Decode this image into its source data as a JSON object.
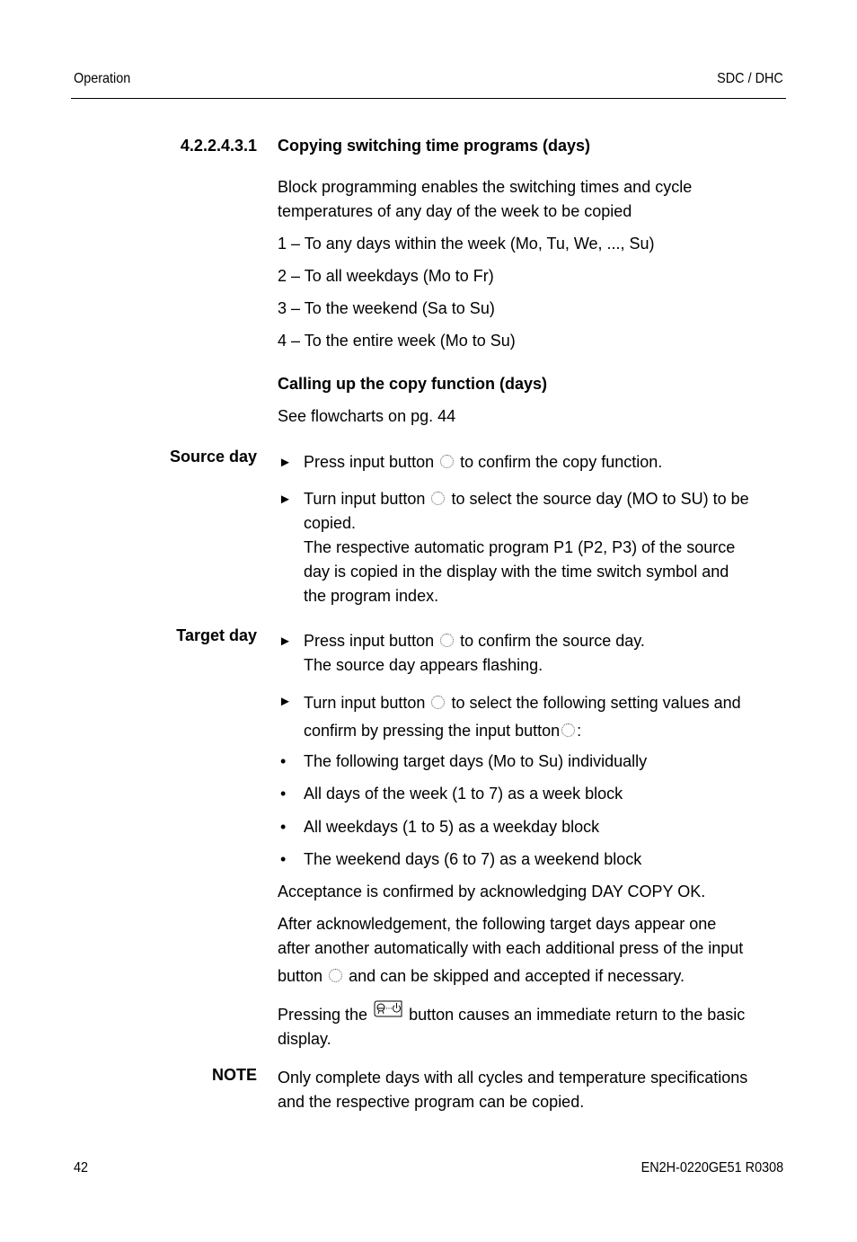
{
  "header": {
    "left": "Operation",
    "right": "SDC / DHC"
  },
  "section": {
    "number": "4.2.2.4.3.1",
    "title": "Copying switching time programs (days)"
  },
  "intro": {
    "para": [
      "Block programming enables the switching times and cycle",
      "temperatures of any day of the week to be copied"
    ],
    "options": [
      "1 – To any days within the week (Mo, Tu, We, ..., Su)",
      "2 – To all weekdays (Mo to Fr)",
      "3 – To the weekend (Sa to Su)",
      "4 – To the entire week (Mo to Su)"
    ]
  },
  "calling": {
    "heading": "Calling up the copy function (days)",
    "text": "See flowcharts on pg. 44"
  },
  "source_day": {
    "label": "Source day",
    "step1": {
      "before": "Press input button",
      "after": "to confirm the copy function."
    },
    "step2": {
      "before": "Turn input button",
      "after": "to select the source day (MO to SU) to be",
      "lines": [
        "copied.",
        "The respective automatic program P1 (P2, P3) of the source",
        "day is copied in the display with the time switch symbol and",
        "the program index."
      ]
    }
  },
  "target_day": {
    "label": "Target day",
    "step1": {
      "before": "Press input button",
      "after": "to confirm the source day.",
      "line2": "The source day appears flashing."
    },
    "step2": {
      "before": "Turn input button",
      "after": "to select the following setting values and",
      "line2": "confirm by pressing the input button",
      "line2_end": ":"
    },
    "bullets": [
      "The following target days (Mo to Su) individually",
      "All days of the week (1 to 7) as a week block",
      "All weekdays (1 to 5) as a weekday block",
      "The weekend days (6 to 7) as a weekend block"
    ],
    "acceptance": "Acceptance is confirmed by acknowledging DAY COPY OK.",
    "after_ack": {
      "line1": "After acknowledgement, the following target days appear one",
      "line2": "after another automatically with each additional press of the input",
      "line3_before": "button",
      "line3_after": "and can be skipped and accepted if necessary."
    },
    "pressing": {
      "before": "Pressing the",
      "after": "button causes an immediate return to the basic",
      "line2": "display."
    }
  },
  "note": {
    "label": "NOTE",
    "lines": [
      "Only complete days with all cycles and temperature specifications",
      "and the respective program can be copied."
    ]
  },
  "footer": {
    "page": "42",
    "doc_id": "EN2H-0220GE51 R0308"
  },
  "icons": {
    "input_button": "input-knob-icon",
    "home_button": "home-return-button-icon"
  }
}
